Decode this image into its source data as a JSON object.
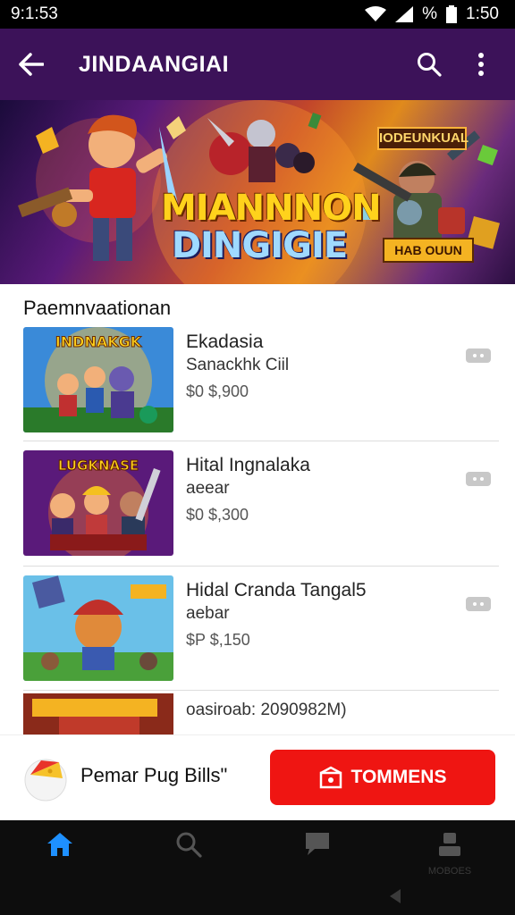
{
  "status_bar": {
    "time": "9:1:53",
    "battery_text": "%",
    "clock_right": "1:50"
  },
  "app_bar": {
    "title": "JINDAANGIAI",
    "back_icon": "arrow-left-icon",
    "search_icon": "search-icon",
    "menu_icon": "more-vert-icon"
  },
  "banner": {
    "title_line1": "MIANNNON",
    "title_line2": "DINGIGIE",
    "badge": "IODEUNKUAL",
    "cta": "HAB OUUN"
  },
  "section": {
    "title": "Paemnvaationan"
  },
  "items": [
    {
      "name": "Ekadasia",
      "sub": "Sanackhk Ciil",
      "price": "$0 $,900",
      "thumb_label": "INDNAKGK"
    },
    {
      "name": "Hital Ingnalaka",
      "sub": "aeear",
      "price": "$0 $,300",
      "thumb_label": "LUGKNASE"
    },
    {
      "name": "Hidal Cranda Tangal5",
      "sub": "aebar",
      "price": "$P $,150",
      "thumb_label": ""
    }
  ],
  "partial_item": {
    "meta": "oasiroab: 2090982M)"
  },
  "promo": {
    "text": "Pemar Pug Bills\"",
    "button_label": "TOMMENS"
  },
  "bottom_nav": [
    {
      "icon": "home-icon",
      "label": "",
      "color": "#1e90ff"
    },
    {
      "icon": "search-icon",
      "label": "",
      "color": "#555555"
    },
    {
      "icon": "chat-icon",
      "label": "",
      "color": "#555555"
    },
    {
      "icon": "profile-icon",
      "label": "MOBOES",
      "color": "#555555"
    }
  ],
  "colors": {
    "app_bar": "#3c1259",
    "promo_button": "#ef1512",
    "nav_active": "#1e90ff"
  }
}
